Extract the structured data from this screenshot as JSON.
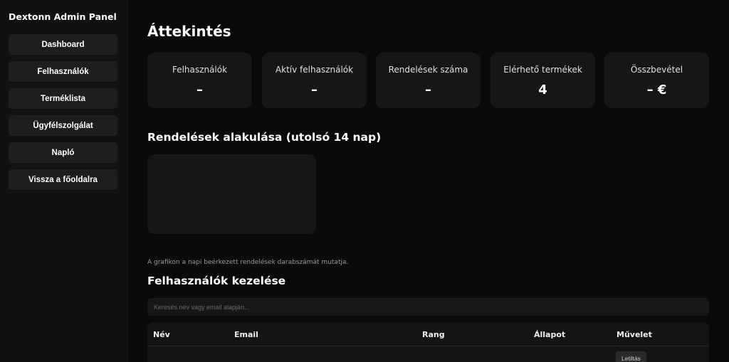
{
  "sidebar": {
    "brand": "Dextonn Admin Panel",
    "items": [
      {
        "label": "Dashboard"
      },
      {
        "label": "Felhasználók"
      },
      {
        "label": "Terméklista"
      },
      {
        "label": "Ügyfélszolgálat"
      },
      {
        "label": "Napló"
      },
      {
        "label": "Vissza a főoldalra"
      }
    ]
  },
  "main": {
    "title": "Áttekintés",
    "stats": [
      {
        "label": "Felhasználók",
        "value": "–"
      },
      {
        "label": "Aktív felhasználók",
        "value": "–"
      },
      {
        "label": "Rendelések száma",
        "value": "–"
      },
      {
        "label": "Elérhető termékek",
        "value": "4"
      },
      {
        "label": "Összbevétel",
        "value": "– €"
      }
    ],
    "chart_section": {
      "title": "Rendelések alakulása (utolsó 14 nap)",
      "note": "A grafikon a napi beérkezett rendelések darabszámát mutatja."
    },
    "users_section": {
      "title": "Felhasználók kezelése",
      "search_placeholder": "Keresés név vagy email alapján...",
      "columns": [
        "Név",
        "Email",
        "Rang",
        "Állapot",
        "Művelet"
      ],
      "first_row": {
        "action_label": "Letiltás"
      }
    }
  }
}
